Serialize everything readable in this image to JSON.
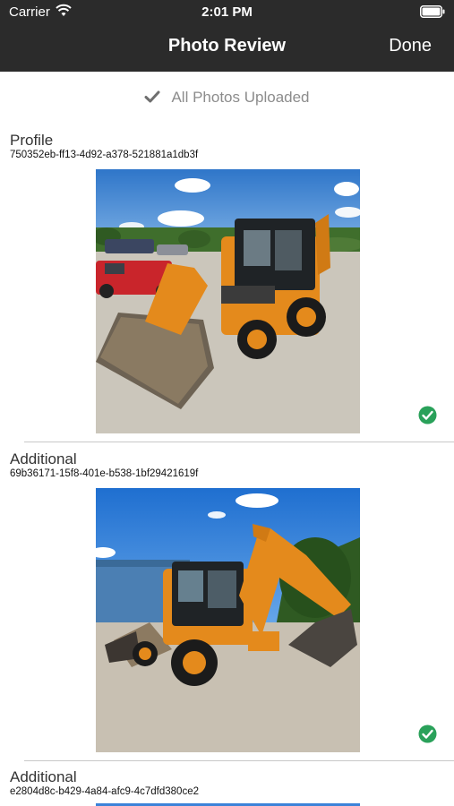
{
  "status_bar": {
    "carrier": "Carrier",
    "time": "2:01 PM"
  },
  "nav": {
    "title": "Photo Review",
    "done_label": "Done"
  },
  "upload": {
    "status_text": "All Photos Uploaded"
  },
  "photos": [
    {
      "label": "Profile",
      "id": "750352eb-ff13-4d92-a378-521881a1db3f",
      "uploaded": true,
      "subject": "backhoe-loader-front-view"
    },
    {
      "label": "Additional",
      "id": "69b36171-15f8-401e-b538-1bf29421619f",
      "uploaded": true,
      "subject": "backhoe-loader-side-view"
    },
    {
      "label": "Additional",
      "id": "e2804d8c-b429-4a84-afc9-4c7dfd380ce2",
      "uploaded": true,
      "subject": "backhoe-loader"
    }
  ],
  "colors": {
    "header_bg": "#2b2b2b",
    "success_green": "#2aa15a",
    "muted_text": "#8c8c8c",
    "machine_orange": "#e48a1c"
  }
}
